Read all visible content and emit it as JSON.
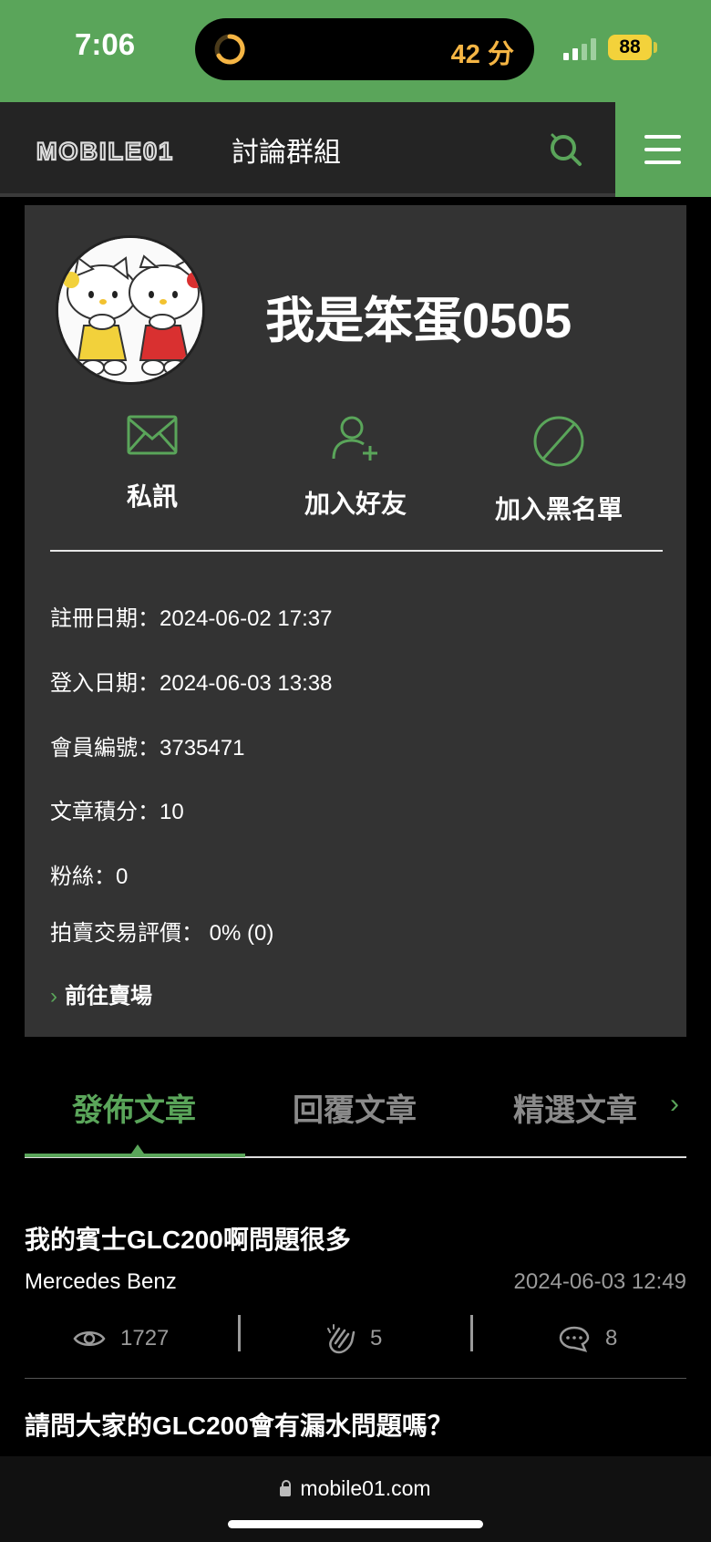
{
  "status": {
    "time": "7:06",
    "island_text": "42 分",
    "battery": "88"
  },
  "header": {
    "logo_text": "MOBILE01",
    "title": "討論群組"
  },
  "profile": {
    "username": "我是笨蛋0505",
    "actions": {
      "message": "私訊",
      "add_friend": "加入好友",
      "block": "加入黑名單"
    },
    "info": {
      "register": "註冊日期：2024-06-02 17:37",
      "login": "登入日期：2024-06-03 13:38",
      "member_id": "會員編號：3735471",
      "points": "文章積分：10",
      "fans": "粉絲：0",
      "rating": "拍賣交易評價： 0% (0)"
    },
    "shop_link": "前往賣場"
  },
  "tabs": {
    "posts": "發佈文章",
    "replies": "回覆文章",
    "featured": "精選文章"
  },
  "posts": [
    {
      "title": "我的賓士GLC200啊問題很多",
      "category": "Mercedes Benz",
      "date": "2024-06-03 12:49",
      "views": "1727",
      "likes": "5",
      "comments": "8"
    },
    {
      "title": "請問大家的GLC200會有漏水問題嗎？"
    }
  ],
  "browser": {
    "url": "mobile01.com"
  },
  "colors": {
    "accent": "#5aa55a",
    "card": "#333333",
    "header": "#242424"
  }
}
